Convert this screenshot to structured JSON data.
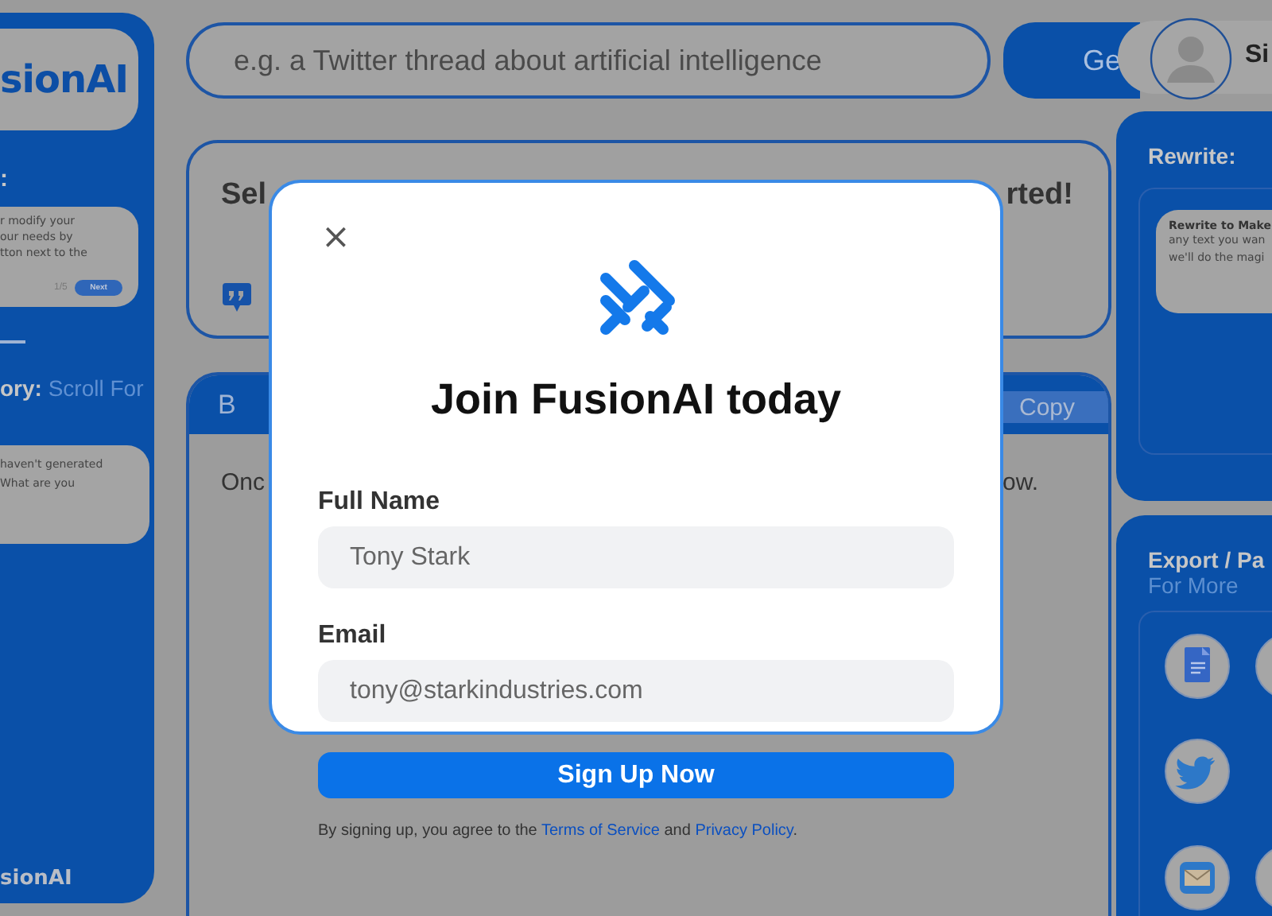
{
  "sidebar": {
    "logo": "sionAI",
    "tips_heading": ":",
    "tip_lines": [
      "r modify your",
      "our needs by",
      "tton next to the"
    ],
    "tip_counter": "1/5",
    "tip_button": "Next",
    "history_label": "ory:",
    "history_hint": "Scroll For",
    "history_lines": [
      "haven't generated",
      "What are you"
    ],
    "footer_logo": "sionAI"
  },
  "topbar": {
    "search": {
      "placeholder": "e.g. a Twitter thread about artificial intelligence"
    },
    "generate_button": "Ge",
    "profile": {
      "name": "Si"
    }
  },
  "prompt_card": {
    "title_start": "Sel",
    "title_end": "rted!"
  },
  "output_card": {
    "header_label": "B",
    "copy_button": "Copy",
    "text_start": "Onc",
    "text_end": "ow."
  },
  "rewrite_panel": {
    "heading": "Rewrite:",
    "card": {
      "title": "Rewrite to Make",
      "lines": [
        "any text you wan",
        "we'll do the magi"
      ]
    }
  },
  "export_panel": {
    "heading": "Export / Pa",
    "subheading": "For More"
  },
  "modal": {
    "close": "×",
    "title": "Join FusionAI today",
    "fields": [
      {
        "label": "Full Name",
        "placeholder": "Tony Stark"
      },
      {
        "label": "Email",
        "placeholder": "tony@starkindustries.com"
      }
    ],
    "submit": "Sign Up Now",
    "terms": [
      {
        "kind": "text",
        "text": "By signing up, you agree to the "
      },
      {
        "kind": "link",
        "text": "Terms of Service"
      },
      {
        "kind": "text",
        "text": " and "
      },
      {
        "kind": "link",
        "text": "Privacy Policy"
      },
      {
        "kind": "text",
        "text": "."
      }
    ]
  }
}
